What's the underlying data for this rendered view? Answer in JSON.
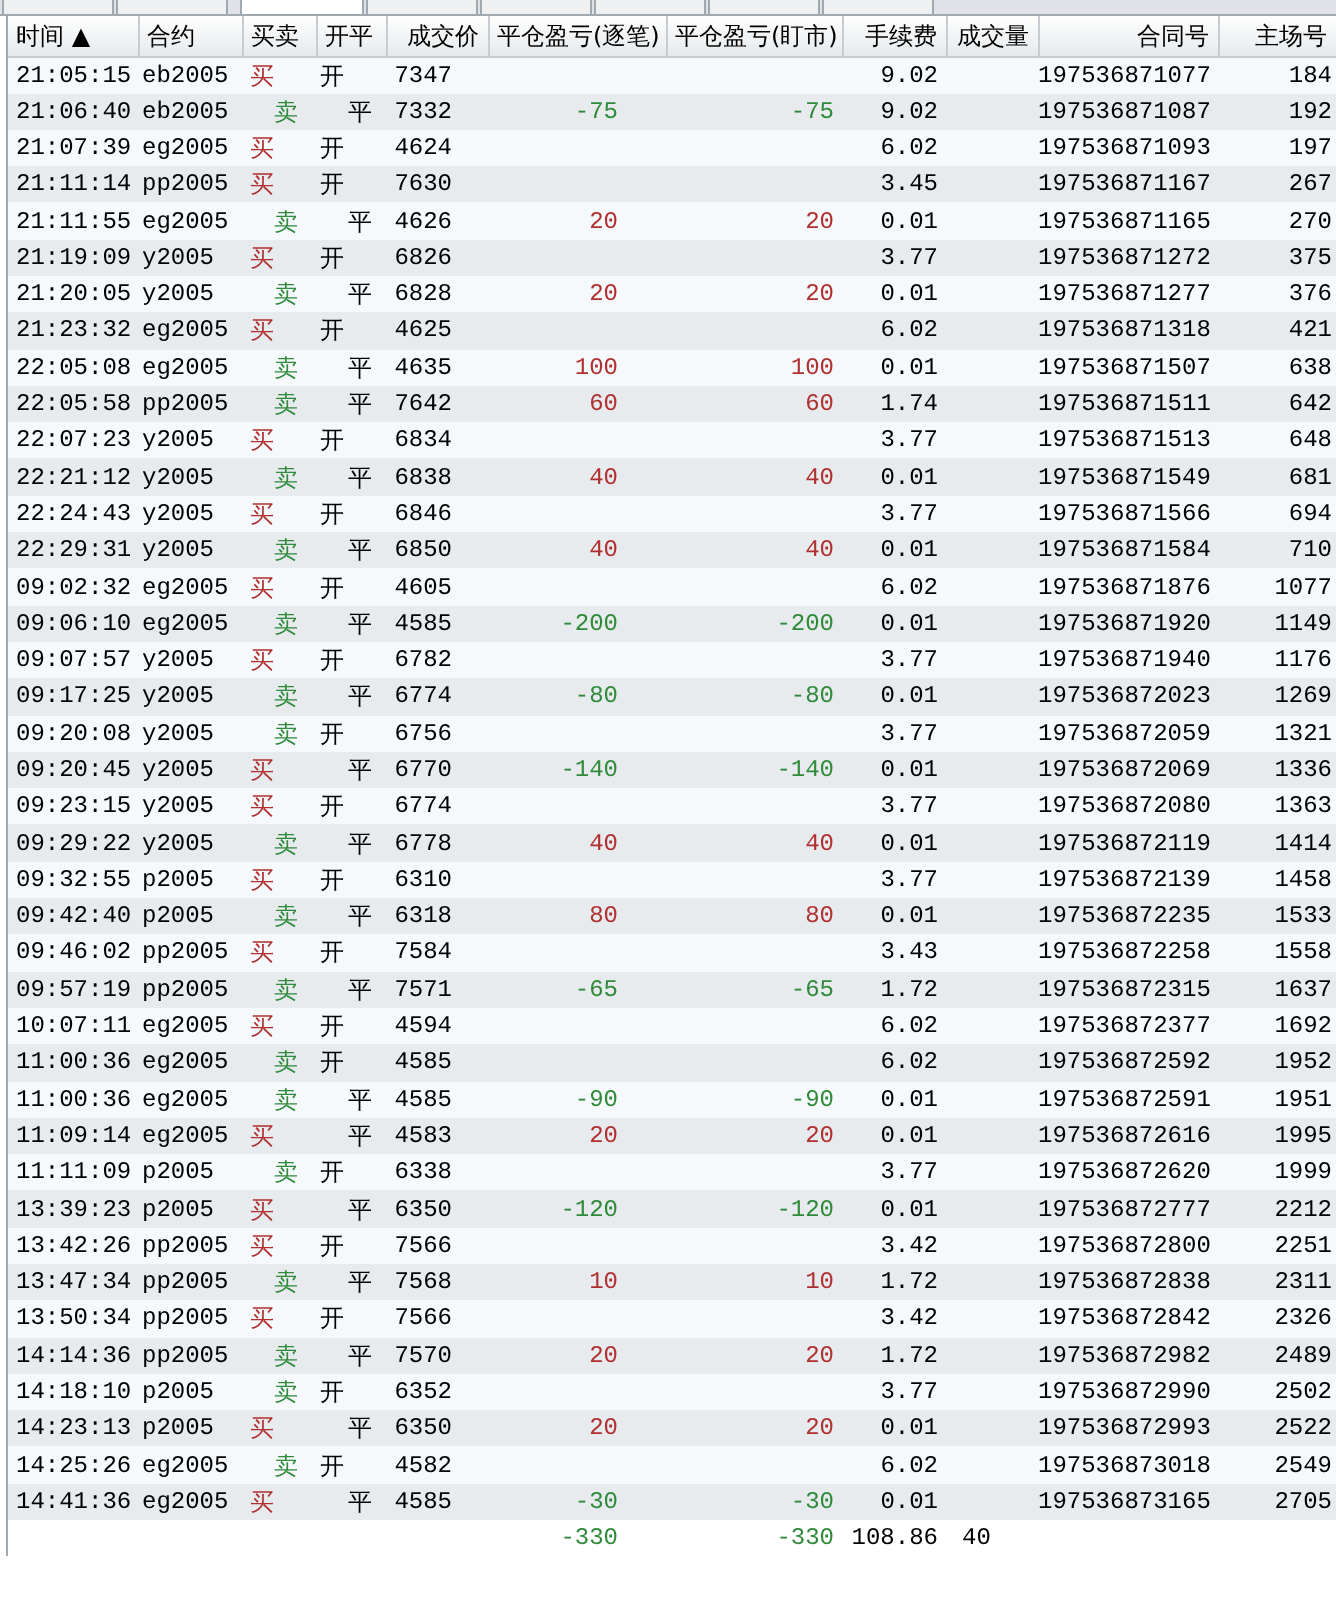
{
  "tabs": [
    {
      "selected": false
    },
    {
      "selected": false
    },
    {
      "selected": true
    },
    {
      "selected": false
    },
    {
      "selected": false
    },
    {
      "selected": false
    },
    {
      "selected": false
    },
    {
      "selected": false
    }
  ],
  "table": {
    "columns": [
      "时间 ▲",
      "合约",
      "买卖",
      "开平",
      "成交价",
      "平仓盈亏(逐笔)",
      "平仓盈亏(盯市)",
      "手续费",
      "成交量",
      "合同号",
      "主场号"
    ],
    "rows": [
      {
        "time": "21:05:15",
        "contract": "eb2005",
        "side": {
          "text": "买",
          "kind": "buy"
        },
        "offset": {
          "text": "开",
          "kind": "open"
        },
        "price": "7347",
        "fee": "9.02",
        "order_no": "197536871077",
        "exchange_no": "184"
      },
      {
        "time": "21:06:40",
        "contract": "eb2005",
        "side": {
          "text": "卖",
          "kind": "sell"
        },
        "offset": {
          "text": "平",
          "kind": "close"
        },
        "price": "7332",
        "pnl": {
          "kind": "loss",
          "trade": "-75",
          "mark": "-75"
        },
        "fee": "9.02",
        "order_no": "197536871087",
        "exchange_no": "192"
      },
      {
        "time": "21:07:39",
        "contract": "eg2005",
        "side": {
          "text": "买",
          "kind": "buy"
        },
        "offset": {
          "text": "开",
          "kind": "open"
        },
        "price": "4624",
        "fee": "6.02",
        "order_no": "197536871093",
        "exchange_no": "197"
      },
      {
        "time": "21:11:14",
        "contract": "pp2005",
        "side": {
          "text": "买",
          "kind": "buy"
        },
        "offset": {
          "text": "开",
          "kind": "open"
        },
        "price": "7630",
        "fee": "3.45",
        "order_no": "197536871167",
        "exchange_no": "267"
      },
      {
        "time": "21:11:55",
        "contract": "eg2005",
        "side": {
          "text": "卖",
          "kind": "sell"
        },
        "offset": {
          "text": "平",
          "kind": "close"
        },
        "price": "4626",
        "pnl": {
          "kind": "gain",
          "trade": "20",
          "mark": "20"
        },
        "fee": "0.01",
        "order_no": "197536871165",
        "exchange_no": "270"
      },
      {
        "time": "21:19:09",
        "contract": "y2005",
        "side": {
          "text": "买",
          "kind": "buy"
        },
        "offset": {
          "text": "开",
          "kind": "open"
        },
        "price": "6826",
        "fee": "3.77",
        "order_no": "197536871272",
        "exchange_no": "375"
      },
      {
        "time": "21:20:05",
        "contract": "y2005",
        "side": {
          "text": "卖",
          "kind": "sell"
        },
        "offset": {
          "text": "平",
          "kind": "close"
        },
        "price": "6828",
        "pnl": {
          "kind": "gain",
          "trade": "20",
          "mark": "20"
        },
        "fee": "0.01",
        "order_no": "197536871277",
        "exchange_no": "376"
      },
      {
        "time": "21:23:32",
        "contract": "eg2005",
        "side": {
          "text": "买",
          "kind": "buy"
        },
        "offset": {
          "text": "开",
          "kind": "open"
        },
        "price": "4625",
        "fee": "6.02",
        "order_no": "197536871318",
        "exchange_no": "421"
      },
      {
        "time": "22:05:08",
        "contract": "eg2005",
        "side": {
          "text": "卖",
          "kind": "sell"
        },
        "offset": {
          "text": "平",
          "kind": "close"
        },
        "price": "4635",
        "pnl": {
          "kind": "gain",
          "trade": "100",
          "mark": "100"
        },
        "fee": "0.01",
        "order_no": "197536871507",
        "exchange_no": "638"
      },
      {
        "time": "22:05:58",
        "contract": "pp2005",
        "side": {
          "text": "卖",
          "kind": "sell"
        },
        "offset": {
          "text": "平",
          "kind": "close"
        },
        "price": "7642",
        "pnl": {
          "kind": "gain",
          "trade": "60",
          "mark": "60"
        },
        "fee": "1.74",
        "order_no": "197536871511",
        "exchange_no": "642"
      },
      {
        "time": "22:07:23",
        "contract": "y2005",
        "side": {
          "text": "买",
          "kind": "buy"
        },
        "offset": {
          "text": "开",
          "kind": "open"
        },
        "price": "6834",
        "fee": "3.77",
        "order_no": "197536871513",
        "exchange_no": "648"
      },
      {
        "time": "22:21:12",
        "contract": "y2005",
        "side": {
          "text": "卖",
          "kind": "sell"
        },
        "offset": {
          "text": "平",
          "kind": "close"
        },
        "price": "6838",
        "pnl": {
          "kind": "gain",
          "trade": "40",
          "mark": "40"
        },
        "fee": "0.01",
        "order_no": "197536871549",
        "exchange_no": "681"
      },
      {
        "time": "22:24:43",
        "contract": "y2005",
        "side": {
          "text": "买",
          "kind": "buy"
        },
        "offset": {
          "text": "开",
          "kind": "open"
        },
        "price": "6846",
        "fee": "3.77",
        "order_no": "197536871566",
        "exchange_no": "694"
      },
      {
        "time": "22:29:31",
        "contract": "y2005",
        "side": {
          "text": "卖",
          "kind": "sell"
        },
        "offset": {
          "text": "平",
          "kind": "close"
        },
        "price": "6850",
        "pnl": {
          "kind": "gain",
          "trade": "40",
          "mark": "40"
        },
        "fee": "0.01",
        "order_no": "197536871584",
        "exchange_no": "710"
      },
      {
        "time": "09:02:32",
        "contract": "eg2005",
        "side": {
          "text": "买",
          "kind": "buy"
        },
        "offset": {
          "text": "开",
          "kind": "open"
        },
        "price": "4605",
        "fee": "6.02",
        "order_no": "197536871876",
        "exchange_no": "1077"
      },
      {
        "time": "09:06:10",
        "contract": "eg2005",
        "side": {
          "text": "卖",
          "kind": "sell"
        },
        "offset": {
          "text": "平",
          "kind": "close"
        },
        "price": "4585",
        "pnl": {
          "kind": "loss",
          "trade": "-200",
          "mark": "-200"
        },
        "fee": "0.01",
        "order_no": "197536871920",
        "exchange_no": "1149"
      },
      {
        "time": "09:07:57",
        "contract": "y2005",
        "side": {
          "text": "买",
          "kind": "buy"
        },
        "offset": {
          "text": "开",
          "kind": "open"
        },
        "price": "6782",
        "fee": "3.77",
        "order_no": "197536871940",
        "exchange_no": "1176"
      },
      {
        "time": "09:17:25",
        "contract": "y2005",
        "side": {
          "text": "卖",
          "kind": "sell"
        },
        "offset": {
          "text": "平",
          "kind": "close"
        },
        "price": "6774",
        "pnl": {
          "kind": "loss",
          "trade": "-80",
          "mark": "-80"
        },
        "fee": "0.01",
        "order_no": "197536872023",
        "exchange_no": "1269"
      },
      {
        "time": "09:20:08",
        "contract": "y2005",
        "side": {
          "text": "卖",
          "kind": "sell"
        },
        "offset": {
          "text": "开",
          "kind": "open"
        },
        "price": "6756",
        "fee": "3.77",
        "order_no": "197536872059",
        "exchange_no": "1321"
      },
      {
        "time": "09:20:45",
        "contract": "y2005",
        "side": {
          "text": "买",
          "kind": "buy"
        },
        "offset": {
          "text": "平",
          "kind": "close"
        },
        "price": "6770",
        "pnl": {
          "kind": "loss",
          "trade": "-140",
          "mark": "-140"
        },
        "fee": "0.01",
        "order_no": "197536872069",
        "exchange_no": "1336"
      },
      {
        "time": "09:23:15",
        "contract": "y2005",
        "side": {
          "text": "买",
          "kind": "buy"
        },
        "offset": {
          "text": "开",
          "kind": "open"
        },
        "price": "6774",
        "fee": "3.77",
        "order_no": "197536872080",
        "exchange_no": "1363"
      },
      {
        "time": "09:29:22",
        "contract": "y2005",
        "side": {
          "text": "卖",
          "kind": "sell"
        },
        "offset": {
          "text": "平",
          "kind": "close"
        },
        "price": "6778",
        "pnl": {
          "kind": "gain",
          "trade": "40",
          "mark": "40"
        },
        "fee": "0.01",
        "order_no": "197536872119",
        "exchange_no": "1414"
      },
      {
        "time": "09:32:55",
        "contract": "p2005",
        "side": {
          "text": "买",
          "kind": "buy"
        },
        "offset": {
          "text": "开",
          "kind": "open"
        },
        "price": "6310",
        "fee": "3.77",
        "order_no": "197536872139",
        "exchange_no": "1458"
      },
      {
        "time": "09:42:40",
        "contract": "p2005",
        "side": {
          "text": "卖",
          "kind": "sell"
        },
        "offset": {
          "text": "平",
          "kind": "close"
        },
        "price": "6318",
        "pnl": {
          "kind": "gain",
          "trade": "80",
          "mark": "80"
        },
        "fee": "0.01",
        "order_no": "197536872235",
        "exchange_no": "1533"
      },
      {
        "time": "09:46:02",
        "contract": "pp2005",
        "side": {
          "text": "买",
          "kind": "buy"
        },
        "offset": {
          "text": "开",
          "kind": "open"
        },
        "price": "7584",
        "fee": "3.43",
        "order_no": "197536872258",
        "exchange_no": "1558"
      },
      {
        "time": "09:57:19",
        "contract": "pp2005",
        "side": {
          "text": "卖",
          "kind": "sell"
        },
        "offset": {
          "text": "平",
          "kind": "close"
        },
        "price": "7571",
        "pnl": {
          "kind": "loss",
          "trade": "-65",
          "mark": "-65"
        },
        "fee": "1.72",
        "order_no": "197536872315",
        "exchange_no": "1637"
      },
      {
        "time": "10:07:11",
        "contract": "eg2005",
        "side": {
          "text": "买",
          "kind": "buy"
        },
        "offset": {
          "text": "开",
          "kind": "open"
        },
        "price": "4594",
        "fee": "6.02",
        "order_no": "197536872377",
        "exchange_no": "1692"
      },
      {
        "time": "11:00:36",
        "contract": "eg2005",
        "side": {
          "text": "卖",
          "kind": "sell"
        },
        "offset": {
          "text": "开",
          "kind": "open"
        },
        "price": "4585",
        "fee": "6.02",
        "order_no": "197536872592",
        "exchange_no": "1952"
      },
      {
        "time": "11:00:36",
        "contract": "eg2005",
        "side": {
          "text": "卖",
          "kind": "sell"
        },
        "offset": {
          "text": "平",
          "kind": "close"
        },
        "price": "4585",
        "pnl": {
          "kind": "loss",
          "trade": "-90",
          "mark": "-90"
        },
        "fee": "0.01",
        "order_no": "197536872591",
        "exchange_no": "1951"
      },
      {
        "time": "11:09:14",
        "contract": "eg2005",
        "side": {
          "text": "买",
          "kind": "buy"
        },
        "offset": {
          "text": "平",
          "kind": "close"
        },
        "price": "4583",
        "pnl": {
          "kind": "gain",
          "trade": "20",
          "mark": "20"
        },
        "fee": "0.01",
        "order_no": "197536872616",
        "exchange_no": "1995"
      },
      {
        "time": "11:11:09",
        "contract": "p2005",
        "side": {
          "text": "卖",
          "kind": "sell"
        },
        "offset": {
          "text": "开",
          "kind": "open"
        },
        "price": "6338",
        "fee": "3.77",
        "order_no": "197536872620",
        "exchange_no": "1999"
      },
      {
        "time": "13:39:23",
        "contract": "p2005",
        "side": {
          "text": "买",
          "kind": "buy"
        },
        "offset": {
          "text": "平",
          "kind": "close"
        },
        "price": "6350",
        "pnl": {
          "kind": "loss",
          "trade": "-120",
          "mark": "-120"
        },
        "fee": "0.01",
        "order_no": "197536872777",
        "exchange_no": "2212"
      },
      {
        "time": "13:42:26",
        "contract": "pp2005",
        "side": {
          "text": "买",
          "kind": "buy"
        },
        "offset": {
          "text": "开",
          "kind": "open"
        },
        "price": "7566",
        "fee": "3.42",
        "order_no": "197536872800",
        "exchange_no": "2251"
      },
      {
        "time": "13:47:34",
        "contract": "pp2005",
        "side": {
          "text": "卖",
          "kind": "sell"
        },
        "offset": {
          "text": "平",
          "kind": "close"
        },
        "price": "7568",
        "pnl": {
          "kind": "gain",
          "trade": "10",
          "mark": "10"
        },
        "fee": "1.72",
        "order_no": "197536872838",
        "exchange_no": "2311"
      },
      {
        "time": "13:50:34",
        "contract": "pp2005",
        "side": {
          "text": "买",
          "kind": "buy"
        },
        "offset": {
          "text": "开",
          "kind": "open"
        },
        "price": "7566",
        "fee": "3.42",
        "order_no": "197536872842",
        "exchange_no": "2326"
      },
      {
        "time": "14:14:36",
        "contract": "pp2005",
        "side": {
          "text": "卖",
          "kind": "sell"
        },
        "offset": {
          "text": "平",
          "kind": "close"
        },
        "price": "7570",
        "pnl": {
          "kind": "gain",
          "trade": "20",
          "mark": "20"
        },
        "fee": "1.72",
        "order_no": "197536872982",
        "exchange_no": "2489"
      },
      {
        "time": "14:18:10",
        "contract": "p2005",
        "side": {
          "text": "卖",
          "kind": "sell"
        },
        "offset": {
          "text": "开",
          "kind": "open"
        },
        "price": "6352",
        "fee": "3.77",
        "order_no": "197536872990",
        "exchange_no": "2502"
      },
      {
        "time": "14:23:13",
        "contract": "p2005",
        "side": {
          "text": "买",
          "kind": "buy"
        },
        "offset": {
          "text": "平",
          "kind": "close"
        },
        "price": "6350",
        "pnl": {
          "kind": "gain",
          "trade": "20",
          "mark": "20"
        },
        "fee": "0.01",
        "order_no": "197536872993",
        "exchange_no": "2522"
      },
      {
        "time": "14:25:26",
        "contract": "eg2005",
        "side": {
          "text": "卖",
          "kind": "sell"
        },
        "offset": {
          "text": "开",
          "kind": "open"
        },
        "price": "4582",
        "fee": "6.02",
        "order_no": "197536873018",
        "exchange_no": "2549"
      },
      {
        "time": "14:41:36",
        "contract": "eg2005",
        "side": {
          "text": "买",
          "kind": "buy"
        },
        "offset": {
          "text": "平",
          "kind": "close"
        },
        "price": "4585",
        "pnl": {
          "kind": "loss",
          "trade": "-30",
          "mark": "-30"
        },
        "fee": "0.01",
        "order_no": "197536873165",
        "exchange_no": "2705"
      }
    ],
    "total": {
      "pnl": {
        "kind": "loss",
        "trade": "-330",
        "mark": "-330"
      },
      "fee": "108.86",
      "volume": "40"
    }
  }
}
